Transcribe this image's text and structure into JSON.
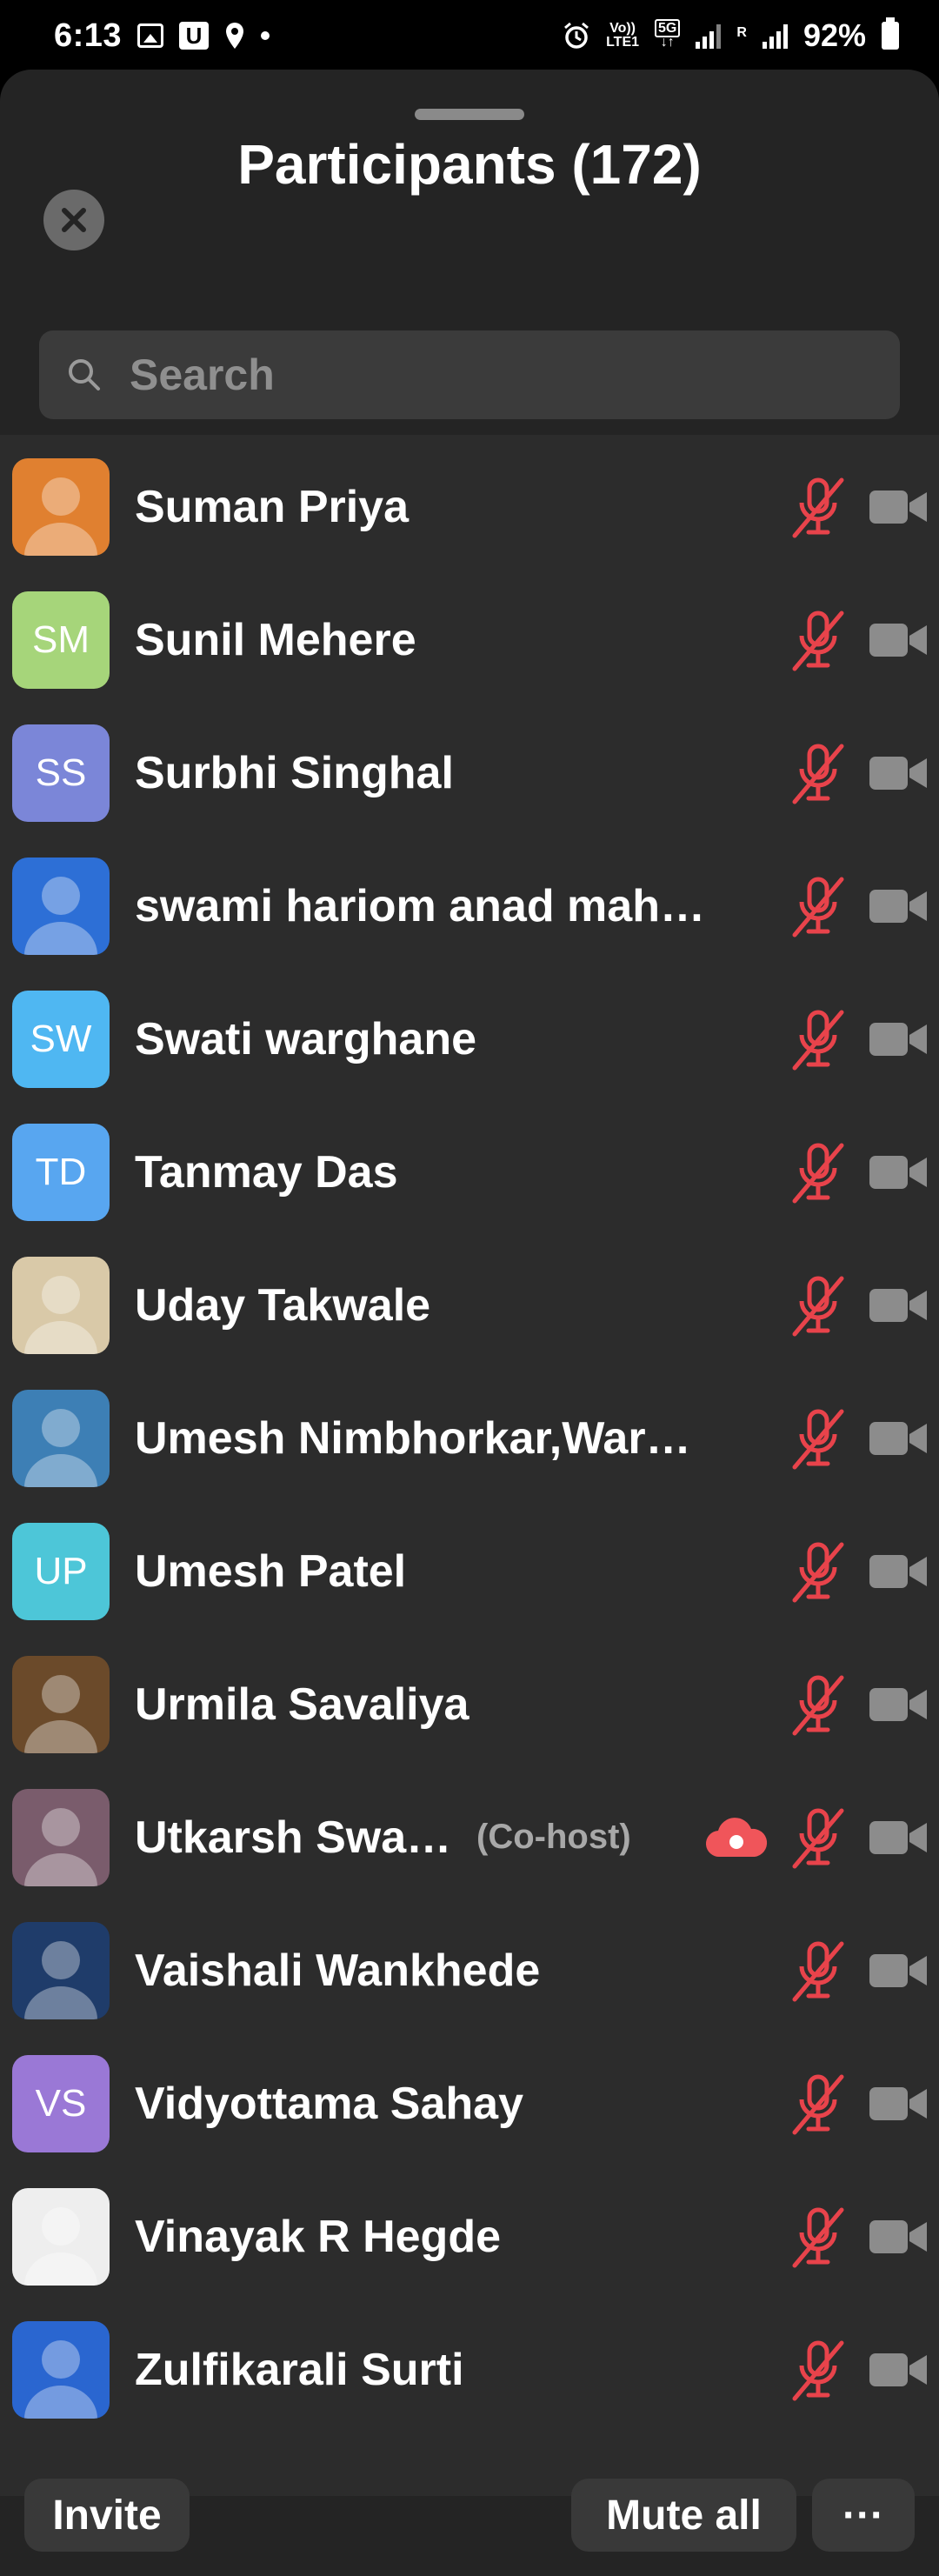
{
  "status_bar": {
    "time": "6:13",
    "icons": [
      "image-icon",
      "u-app-icon",
      "location-icon",
      "dot-icon"
    ],
    "network_line1": "Vo))",
    "network_line2": "LTE1",
    "net_5g": "5G",
    "roaming": "R",
    "battery": "92%"
  },
  "header": {
    "title": "Participants (172)"
  },
  "search": {
    "placeholder": "Search"
  },
  "participants": [
    {
      "name": "Suman Priya",
      "initials": "",
      "avatar_color": "#e08030",
      "muted": true
    },
    {
      "name": "Sunil Mehere",
      "initials": "SM",
      "avatar_color": "#a6d57a",
      "muted": true
    },
    {
      "name": "Surbhi Singhal",
      "initials": "SS",
      "avatar_color": "#7b86d8",
      "muted": true
    },
    {
      "name": "swami hariom anad mah…",
      "initials": "",
      "avatar_color": "#2d6fd6",
      "muted": true
    },
    {
      "name": "Swati warghane",
      "initials": "SW",
      "avatar_color": "#4fb7f2",
      "muted": true
    },
    {
      "name": "Tanmay Das",
      "initials": "TD",
      "avatar_color": "#58a6f0",
      "muted": true
    },
    {
      "name": "Uday Takwale",
      "initials": "",
      "avatar_color": "#d9c9a8",
      "muted": true
    },
    {
      "name": "Umesh Nimbhorkar,War…",
      "initials": "",
      "avatar_color": "#3d7fb5",
      "muted": true
    },
    {
      "name": "Umesh Patel",
      "initials": "UP",
      "avatar_color": "#4dc6d8",
      "muted": true
    },
    {
      "name": "Urmila Savaliya",
      "initials": "",
      "avatar_color": "#6b4a2a",
      "muted": true
    },
    {
      "name": "Utkarsh Swa…",
      "initials": "",
      "avatar_color": "#7a5c6c",
      "muted": true,
      "role": "(Co-host)",
      "cloud_recording": true
    },
    {
      "name": "Vaishali Wankhede",
      "initials": "",
      "avatar_color": "#1f3c6a",
      "muted": true
    },
    {
      "name": "Vidyottama Sahay",
      "initials": "VS",
      "avatar_color": "#9a78d6",
      "muted": true
    },
    {
      "name": "Vinayak R Hegde",
      "initials": "",
      "avatar_color": "#eeeeee",
      "muted": true
    },
    {
      "name": "Zulfikarali Surti",
      "initials": "",
      "avatar_color": "#2a66d0",
      "muted": true
    }
  ],
  "footer": {
    "invite_label": "Invite",
    "mute_all_label": "Mute all",
    "more_label": "···"
  },
  "colors": {
    "muted_red": "#e8434b",
    "cloud_red": "#f0555a",
    "camera_gray": "#8c8c8c"
  }
}
